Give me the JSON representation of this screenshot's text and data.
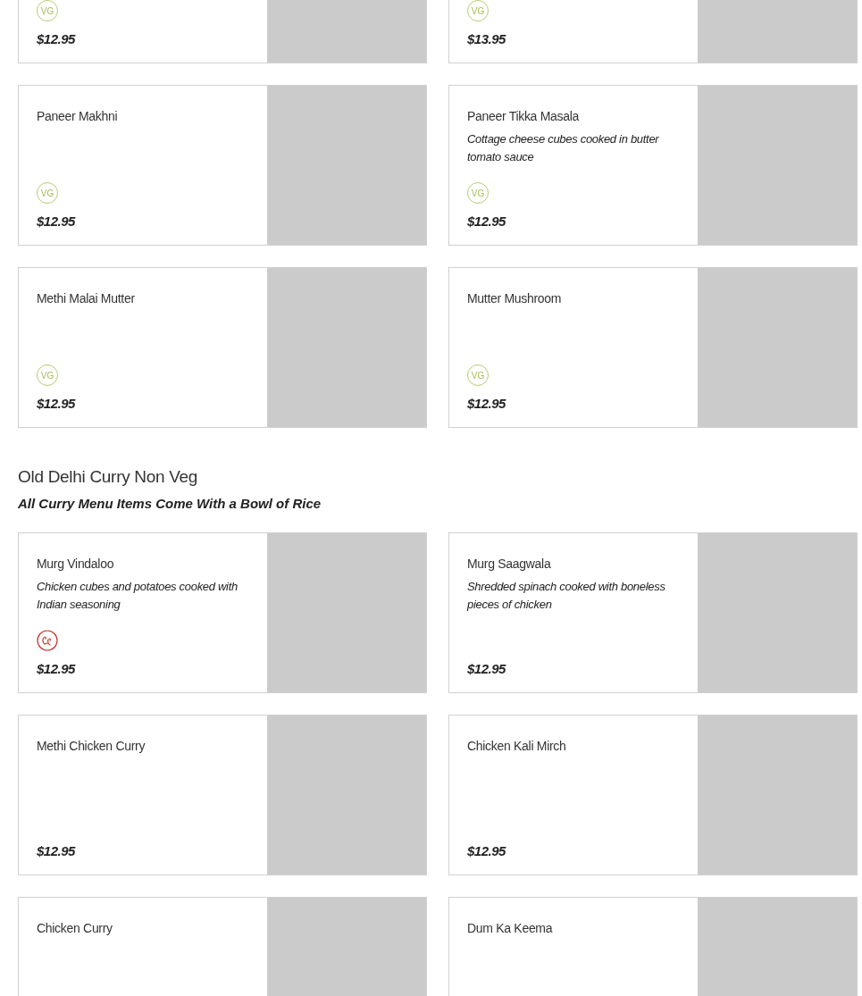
{
  "sections": [
    {
      "cards": [
        {
          "badge": {
            "kind": "vegetarian",
            "label": "VG"
          },
          "price": "$12.95"
        },
        {
          "badge": {
            "kind": "vegetarian",
            "label": "VG"
          },
          "price": "$13.95"
        },
        {
          "name": "Paneer Makhni",
          "badge": {
            "kind": "vegetarian",
            "label": "VG"
          },
          "price": "$12.95"
        },
        {
          "name": "Paneer Tikka Masala",
          "description": "Cottage cheese cubes cooked in butter tomato sauce",
          "badge": {
            "kind": "vegetarian",
            "label": "VG"
          },
          "price": "$12.95"
        },
        {
          "name": "Methi Malai Mutter",
          "badge": {
            "kind": "vegetarian",
            "label": "VG"
          },
          "price": "$12.95"
        },
        {
          "name": "Mutter Mushroom",
          "badge": {
            "kind": "vegetarian",
            "label": "VG"
          },
          "price": "$12.95"
        }
      ]
    },
    {
      "title": "Old Delhi Curry Non Veg",
      "subtitle": "All Curry Menu Items Come With a Bowl of Rice",
      "cards": [
        {
          "name": "Murg Vindaloo",
          "description": "Chicken cubes and potatoes cooked with Indian seasoning",
          "badge": {
            "kind": "spicy"
          },
          "price": "$12.95"
        },
        {
          "name": "Murg Saagwala",
          "description": "Shredded spinach cooked with boneless pieces of chicken",
          "price": "$12.95"
        },
        {
          "name": "Methi Chicken Curry",
          "price": "$12.95"
        },
        {
          "name": "Chicken Kali Mirch",
          "price": "$12.95"
        },
        {
          "name": "Chicken Curry"
        },
        {
          "name": "Dum Ka Keema"
        }
      ]
    }
  ]
}
